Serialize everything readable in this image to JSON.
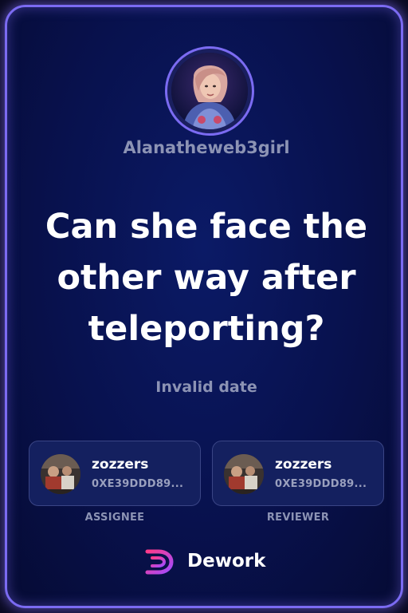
{
  "profile": {
    "username": "Alanatheweb3girl"
  },
  "task": {
    "title": "Can she face the other way after teleporting?",
    "date": "Invalid date"
  },
  "assignee": {
    "name": "zozzers",
    "address": "0XE39DDD89...",
    "role_label": "ASSIGNEE"
  },
  "reviewer": {
    "name": "zozzers",
    "address": "0XE39DDD89...",
    "role_label": "REVIEWER"
  },
  "brand": {
    "name": "Dework",
    "logo_icon": "dework-logo-icon"
  },
  "colors": {
    "accent": "#7b6bf2",
    "background": "#08114d",
    "muted_text": "#8c93b4",
    "logo_gradient_start": "#ff3b8a",
    "logo_gradient_end": "#a14bff"
  }
}
